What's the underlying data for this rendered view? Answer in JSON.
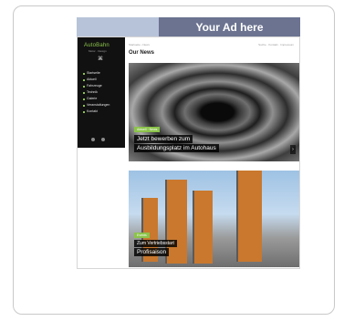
{
  "ad": {
    "text": "Your Ad here"
  },
  "site": {
    "logo": "AutoBahn",
    "logo_sub": "Motor · Design",
    "logo_mark": "⌘",
    "breadcrumb": "Startseite › News",
    "top_right": "Suche · Kontakt · Impressum",
    "heading": "Our News",
    "nav_items": [
      "Startseite",
      "Aktuell",
      "Fahrzeuge",
      "Technik",
      "Galerie",
      "Veranstaltungen",
      "Kontakt"
    ],
    "news": [
      {
        "tag": "Aktuell · News",
        "line1": "Jetzt bewerben zum",
        "line2": "Ausbildungsplatz im Autohaus"
      },
      {
        "tag": "Events",
        "line1": "Zum Vertriebsstart",
        "line2": "Profisaison"
      }
    ]
  }
}
